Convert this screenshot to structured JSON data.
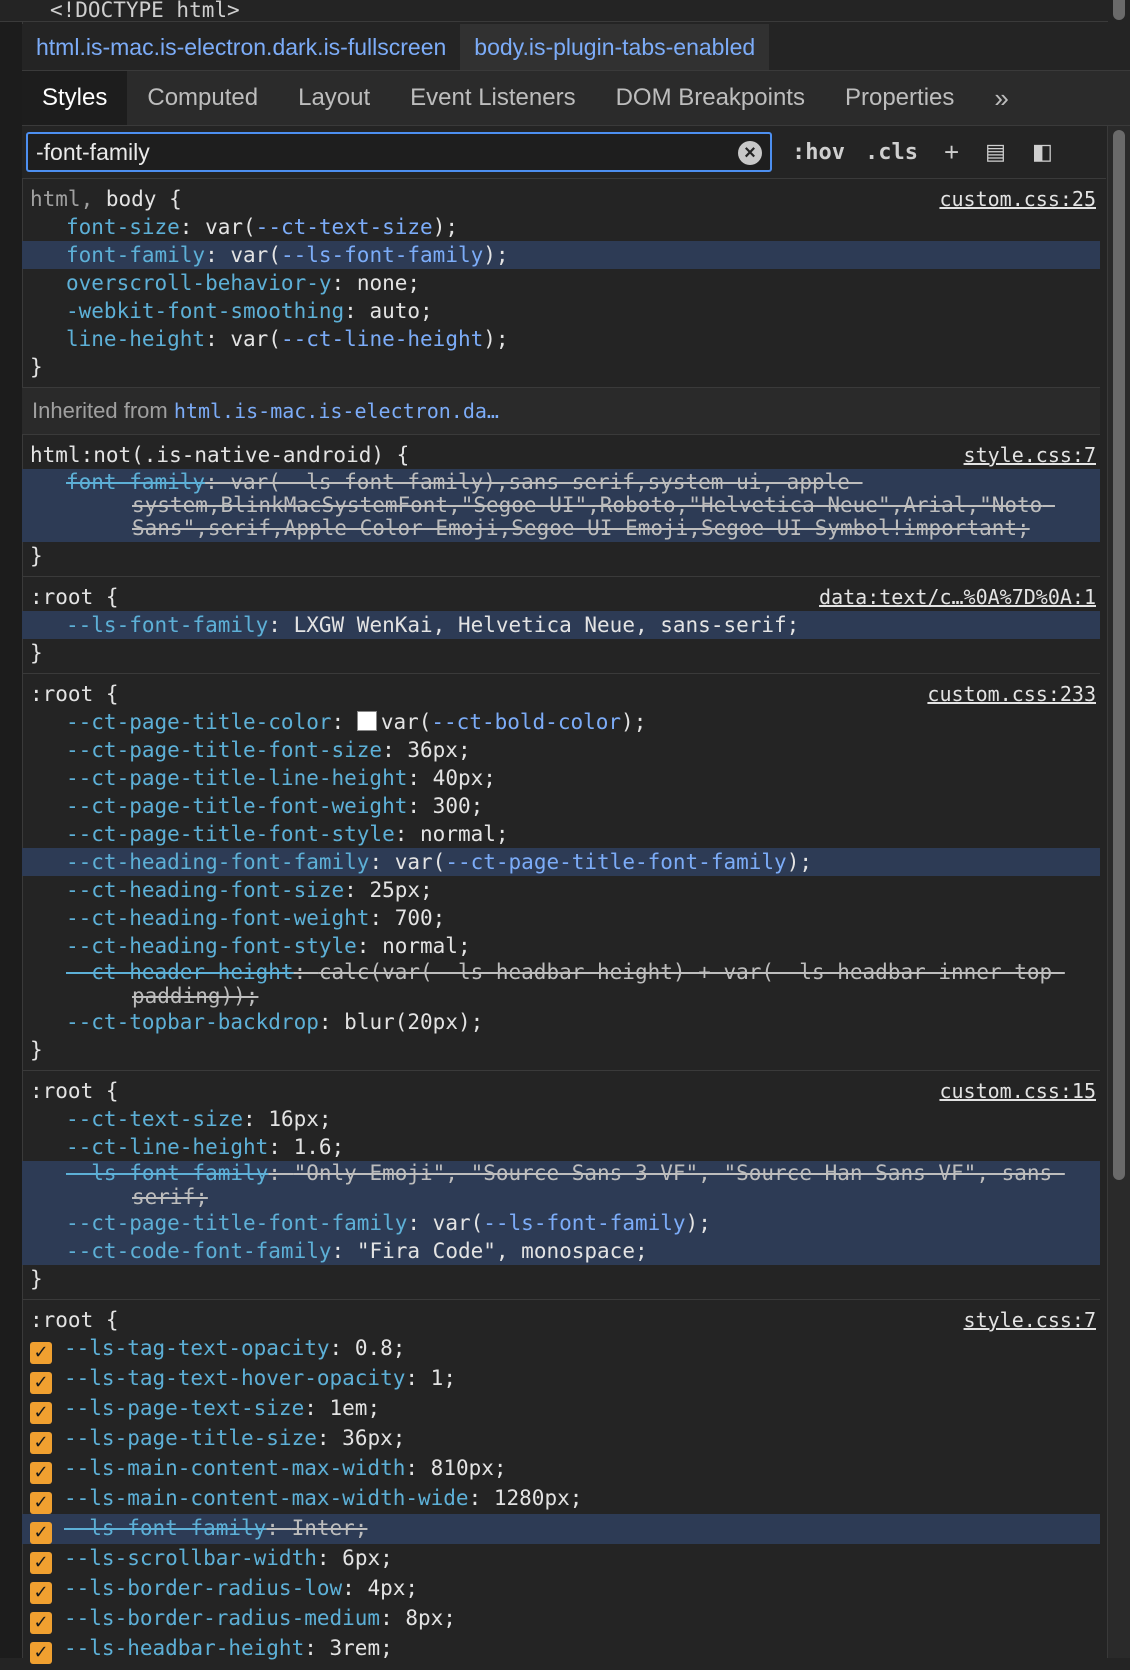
{
  "doctype": "<!DOCTYPE html>",
  "breadcrumbs": {
    "html_tag": "html",
    "html_classes": ".is-mac.is-electron.dark.is-fullscreen",
    "body_tag": "body",
    "body_classes": ".is-plugin-tabs-enabled"
  },
  "tabs": [
    "Styles",
    "Computed",
    "Layout",
    "Event Listeners",
    "DOM Breakpoints",
    "Properties"
  ],
  "tabs_more": "»",
  "filter": {
    "value": "-font-family",
    "hov": ":hov",
    "cls": ".cls"
  },
  "rules": {
    "r1": {
      "selector_a": "html,",
      "selector_b": "body {",
      "source": "custom.css:25",
      "decls": [
        {
          "p": "font-size",
          "v1": "var(",
          "v2": "--ct-text-size",
          "v3": ");"
        },
        {
          "p": "font-family",
          "v1": "var(",
          "v2": "--ls-font-family",
          "v3": ");"
        },
        {
          "p": "overscroll-behavior-y",
          "v1": "none;",
          "v2": "",
          "v3": ""
        },
        {
          "p": "-webkit-font-smoothing",
          "v1": "auto;",
          "v2": "",
          "v3": ""
        },
        {
          "p": "line-height",
          "v1": "var(",
          "v2": "--ct-line-height",
          "v3": ");"
        }
      ]
    },
    "inherited_label": "Inherited from",
    "inherited_target": "html.is-mac.is-electron.da…",
    "r2": {
      "selector": "html:not(.is-native-android) {",
      "source": "style.css:7",
      "prop": "font-family",
      "value": "var(--ls-font-family),sans-serif,system-ui,-apple-system,BlinkMacSystemFont,\"Segoe UI\",Roboto,\"Helvetica Neue\",Arial,\"Noto Sans\",serif,Apple Color Emoji,Segoe UI Emoji,Segoe UI Symbol!important;"
    },
    "r3": {
      "selector": ":root {",
      "source": "data:text/c…%0A%7D%0A:1",
      "prop": "--ls-font-family",
      "value": "LXGW WenKai, Helvetica Neue, sans-serif;"
    },
    "r4": {
      "selector": ":root {",
      "source": "custom.css:233",
      "d1p": "--ct-page-title-color",
      "d1v1": "var(",
      "d1v2": "--ct-bold-color",
      "d1v3": ");",
      "d2p": "--ct-page-title-font-size",
      "d2v": "36px;",
      "d3p": "--ct-page-title-line-height",
      "d3v": "40px;",
      "d4p": "--ct-page-title-font-weight",
      "d4v": "300;",
      "d5p": "--ct-page-title-font-style",
      "d5v": "normal;",
      "d6p": "--ct-heading-font-family",
      "d6v1": "var(",
      "d6v2": "--ct-page-title-font-family",
      "d6v3": ");",
      "d7p": "--ct-heading-font-size",
      "d7v": "25px;",
      "d8p": "--ct-heading-font-weight",
      "d8v": "700;",
      "d9p": "--ct-heading-font-style",
      "d9v": "normal;",
      "d10p": "--ct-header-height",
      "d10v": "calc(var(--ls-headbar-height) + var(--ls-headbar-inner-top-padding));",
      "d11p": "--ct-topbar-backdrop",
      "d11v": "blur(20px);"
    },
    "r5": {
      "selector": ":root {",
      "source": "custom.css:15",
      "d1p": "--ct-text-size",
      "d1v": "16px;",
      "d2p": "--ct-line-height",
      "d2v": "1.6;",
      "d3p": "--ls-font-family",
      "d3v": "\"Only Emoji\", \"Source Sans 3 VF\", \"Source Han Sans VF\", sans-serif;",
      "d4p": "--ct-page-title-font-family",
      "d4v1": "var(",
      "d4v2": "--ls-font-family",
      "d4v3": ");",
      "d5p": "--ct-code-font-family",
      "d5v": "\"Fira Code\", monospace;"
    },
    "r6": {
      "selector": ":root {",
      "source": "style.css:7",
      "decls": [
        {
          "p": "--ls-tag-text-opacity",
          "v": "0.8;"
        },
        {
          "p": "--ls-tag-text-hover-opacity",
          "v": "1;"
        },
        {
          "p": "--ls-page-text-size",
          "v": "1em;"
        },
        {
          "p": "--ls-page-title-size",
          "v": "36px;"
        },
        {
          "p": "--ls-main-content-max-width",
          "v": "810px;"
        },
        {
          "p": "--ls-main-content-max-width-wide",
          "v": "1280px;"
        },
        {
          "p": "--ls-font-family",
          "v": "Inter;"
        },
        {
          "p": "--ls-scrollbar-width",
          "v": "6px;"
        },
        {
          "p": "--ls-border-radius-low",
          "v": "4px;"
        },
        {
          "p": "--ls-border-radius-medium",
          "v": "8px;"
        },
        {
          "p": "--ls-headbar-height",
          "v": "3rem;"
        }
      ]
    },
    "close": "}",
    "colon": ": "
  }
}
